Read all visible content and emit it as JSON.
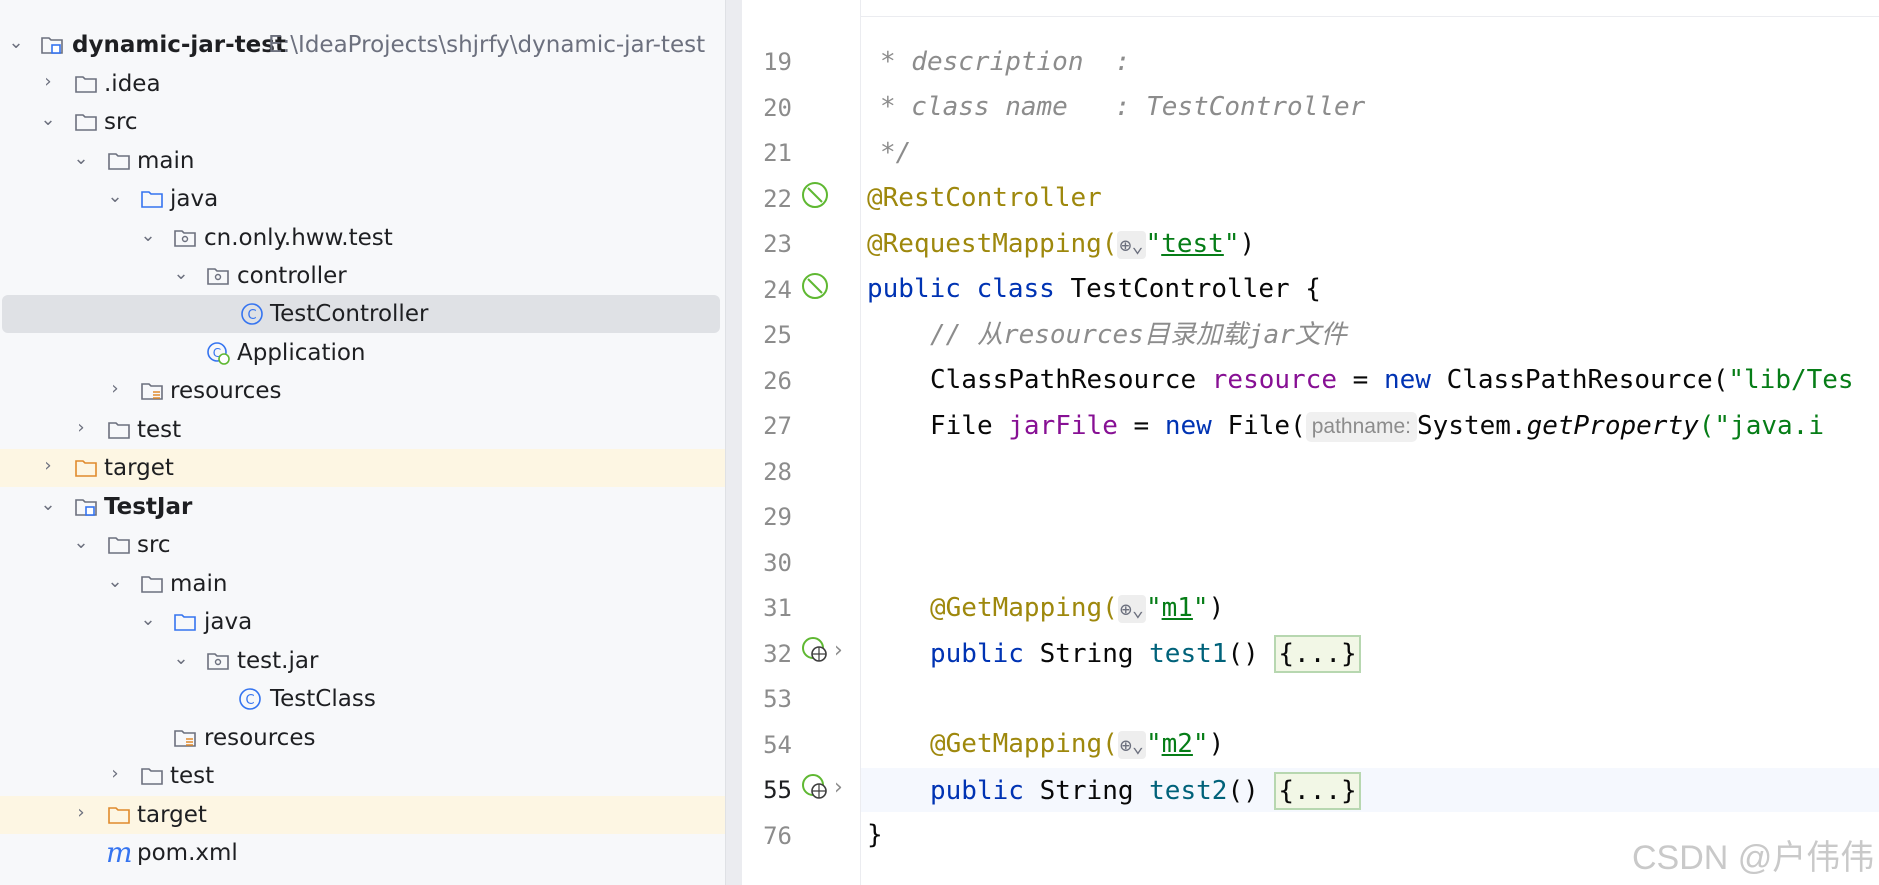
{
  "project_tree": {
    "root": {
      "name": "dynamic-jar-test",
      "path": "E:\\IdeaProjects\\shjrfy\\dynamic-jar-test"
    },
    "items": [
      {
        "label": "dynamic-jar-test",
        "icon": "module-folder-icon",
        "arrow": "expanded"
      },
      {
        "label": ".idea",
        "icon": "folder-icon",
        "arrow": "collapsed"
      },
      {
        "label": "src",
        "icon": "folder-icon",
        "arrow": "expanded"
      },
      {
        "label": "main",
        "icon": "folder-icon",
        "arrow": "expanded"
      },
      {
        "label": "java",
        "icon": "source-folder-icon",
        "arrow": "expanded"
      },
      {
        "label": "cn.only.hww.test",
        "icon": "package-icon",
        "arrow": "expanded"
      },
      {
        "label": "controller",
        "icon": "package-icon",
        "arrow": "expanded"
      },
      {
        "label": "TestController",
        "icon": "class-icon",
        "selected": true
      },
      {
        "label": "Application",
        "icon": "spring-boot-class-icon"
      },
      {
        "label": "resources",
        "icon": "resources-folder-icon",
        "arrow": "collapsed"
      },
      {
        "label": "test",
        "icon": "folder-icon",
        "arrow": "collapsed"
      },
      {
        "label": "target",
        "icon": "excluded-folder-icon",
        "arrow": "collapsed",
        "excluded": true
      },
      {
        "label": "TestJar",
        "icon": "module-folder-icon",
        "arrow": "expanded"
      },
      {
        "label": "src",
        "icon": "folder-icon",
        "arrow": "expanded"
      },
      {
        "label": "main",
        "icon": "folder-icon",
        "arrow": "expanded"
      },
      {
        "label": "java",
        "icon": "source-folder-icon",
        "arrow": "expanded"
      },
      {
        "label": "test.jar",
        "icon": "package-icon",
        "arrow": "expanded"
      },
      {
        "label": "TestClass",
        "icon": "class-icon"
      },
      {
        "label": "resources",
        "icon": "resources-folder-icon"
      },
      {
        "label": "test",
        "icon": "folder-icon",
        "arrow": "collapsed"
      },
      {
        "label": "target",
        "icon": "excluded-folder-icon",
        "arrow": "collapsed",
        "excluded": true
      },
      {
        "label": "pom.xml",
        "icon": "maven-icon"
      }
    ]
  },
  "editor": {
    "line_numbers": [
      "19",
      "20",
      "21",
      "22",
      "23",
      "24",
      "25",
      "26",
      "27",
      "28",
      "29",
      "30",
      "31",
      "32",
      "53",
      "54",
      "55",
      "76"
    ],
    "current_line": "55",
    "code": {
      "l19": "* description  :",
      "l20": "* class name   : TestController",
      "l21": "*/",
      "l22": "@RestController",
      "l23_ann": "@RequestMapping(",
      "l23_str": "test",
      "l24_kw": "public class ",
      "l24_name": "TestController {",
      "l25": "// 从resources目录加载jar文件",
      "l26_type": "ClassPathResource ",
      "l26_var": "resource",
      "l26_eq": " = ",
      "l26_new": "new ",
      "l26_call": "ClassPathResource(",
      "l26_str": "\"lib/Tes",
      "l27_type": "File ",
      "l27_var": "jarFile",
      "l27_eq": " = ",
      "l27_new": "new ",
      "l27_call": "File(",
      "l27_hint": "pathname:",
      "l27_sys": "System.",
      "l27_method": "getProperty",
      "l27_str": "(\"java.i",
      "l31_ann": "@GetMapping(",
      "l31_str": "m1",
      "l32_kw": "public ",
      "l32_type": "String ",
      "l32_method": "test1",
      "l32_rest": "() ",
      "l54_ann": "@GetMapping(",
      "l54_str": "m2",
      "l55_kw": "public ",
      "l55_type": "String ",
      "l55_method": "test2",
      "l55_rest": "() ",
      "folded": "{...}",
      "close": ")",
      "l76": "}"
    }
  },
  "watermark": "CSDN @户伟伟"
}
